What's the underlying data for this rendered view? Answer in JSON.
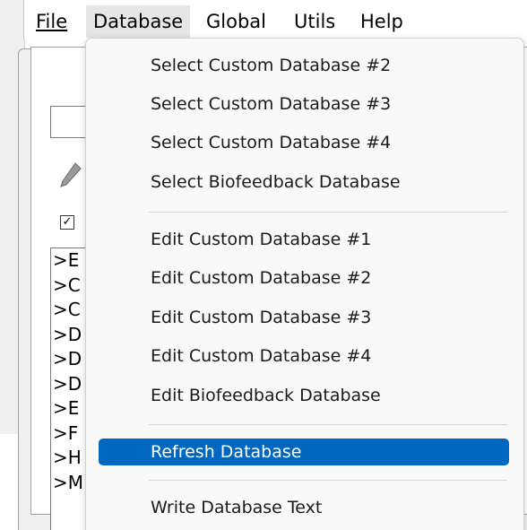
{
  "menubar": {
    "items": [
      {
        "label": "File"
      },
      {
        "label": "Database"
      },
      {
        "label": "Global"
      },
      {
        "label": "Utils"
      },
      {
        "label": "Help"
      }
    ],
    "active": "Database"
  },
  "background": {
    "list_items": [
      ">E",
      ">C",
      ">C",
      ">D",
      ">D",
      ">D",
      ">E",
      ">F",
      ">H",
      ">M"
    ],
    "checkbox_checked": true
  },
  "dropdown": {
    "group1": [
      {
        "label": "Select Custom Database #2"
      },
      {
        "label": "Select Custom Database #3"
      },
      {
        "label": "Select Custom Database #4"
      },
      {
        "label": "Select Biofeedback Database"
      }
    ],
    "group2": [
      {
        "label": "Edit Custom Database #1"
      },
      {
        "label": "Edit Custom Database #2"
      },
      {
        "label": "Edit Custom Database #3"
      },
      {
        "label": "Edit Custom Database #4"
      },
      {
        "label": "Edit Biofeedback Database"
      }
    ],
    "group3": [
      {
        "label": "Refresh Database",
        "highlighted": true
      }
    ],
    "group4": [
      {
        "label": "Write Database Text"
      }
    ]
  },
  "colors": {
    "highlight": "#0067c0",
    "menu_bg": "#f9f9f9",
    "window_bg": "#f0f0f0"
  }
}
